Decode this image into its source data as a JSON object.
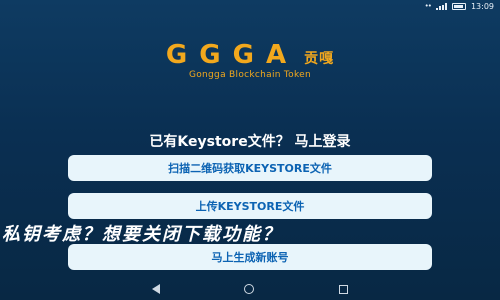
{
  "status_bar": {
    "time": "13:09",
    "dots": "••"
  },
  "logo": {
    "letters": "GGGA",
    "cn": "贡嘎",
    "subtitle": "Gongga Blockchain Token"
  },
  "prompt": "已有Keystore文件？ 马上登录",
  "buttons": {
    "scan": "扫描二维码获取KEYSTORE文件",
    "upload": "上传KEYSTORE文件",
    "create": "马上生成新账号"
  },
  "overlay": "私钥考虑？想要关闭下载功能？",
  "colors": {
    "background": "#0a2f52",
    "accent": "#f2a81d",
    "button_bg": "#e8f5fb",
    "button_text": "#0c63b3"
  }
}
